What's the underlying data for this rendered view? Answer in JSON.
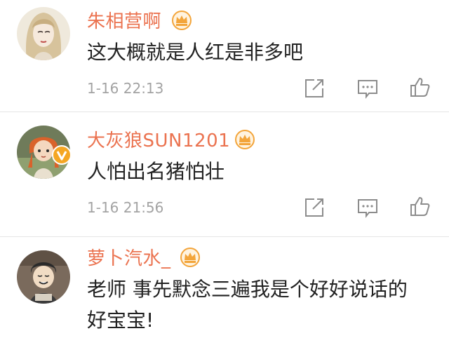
{
  "comments": [
    {
      "username": "朱相营啊",
      "text": "这大概就是人红是非多吧",
      "time": "1-16 22:13",
      "avatar_icon": "woman-portrait-avatar",
      "badge_icon": "crown-vip-icon"
    },
    {
      "username": "大灰狼SUN1201",
      "text": "人怕出名猪怕壮",
      "time": "1-16 21:56",
      "avatar_icon": "anime-girl-avatar",
      "verified_icon": "verified-v-badge",
      "badge_icon": "crown-vip-icon"
    },
    {
      "username": "萝卜汽水_",
      "text_line1": "老师 事先默念三遍我是个好好说话的",
      "text_line2": "好宝宝!",
      "avatar_icon": "cartoon-boy-avatar",
      "badge_icon": "crown-vip-icon"
    }
  ],
  "actions": {
    "share_icon": "share-icon",
    "reply_icon": "reply-icon",
    "like_icon": "like-icon"
  },
  "colors": {
    "username": "#eb7350",
    "crown": "#f3a53b",
    "text": "#222222",
    "time": "#a3a3a3",
    "icon": "#8c8c8c",
    "divider": "#e6e6e6"
  }
}
